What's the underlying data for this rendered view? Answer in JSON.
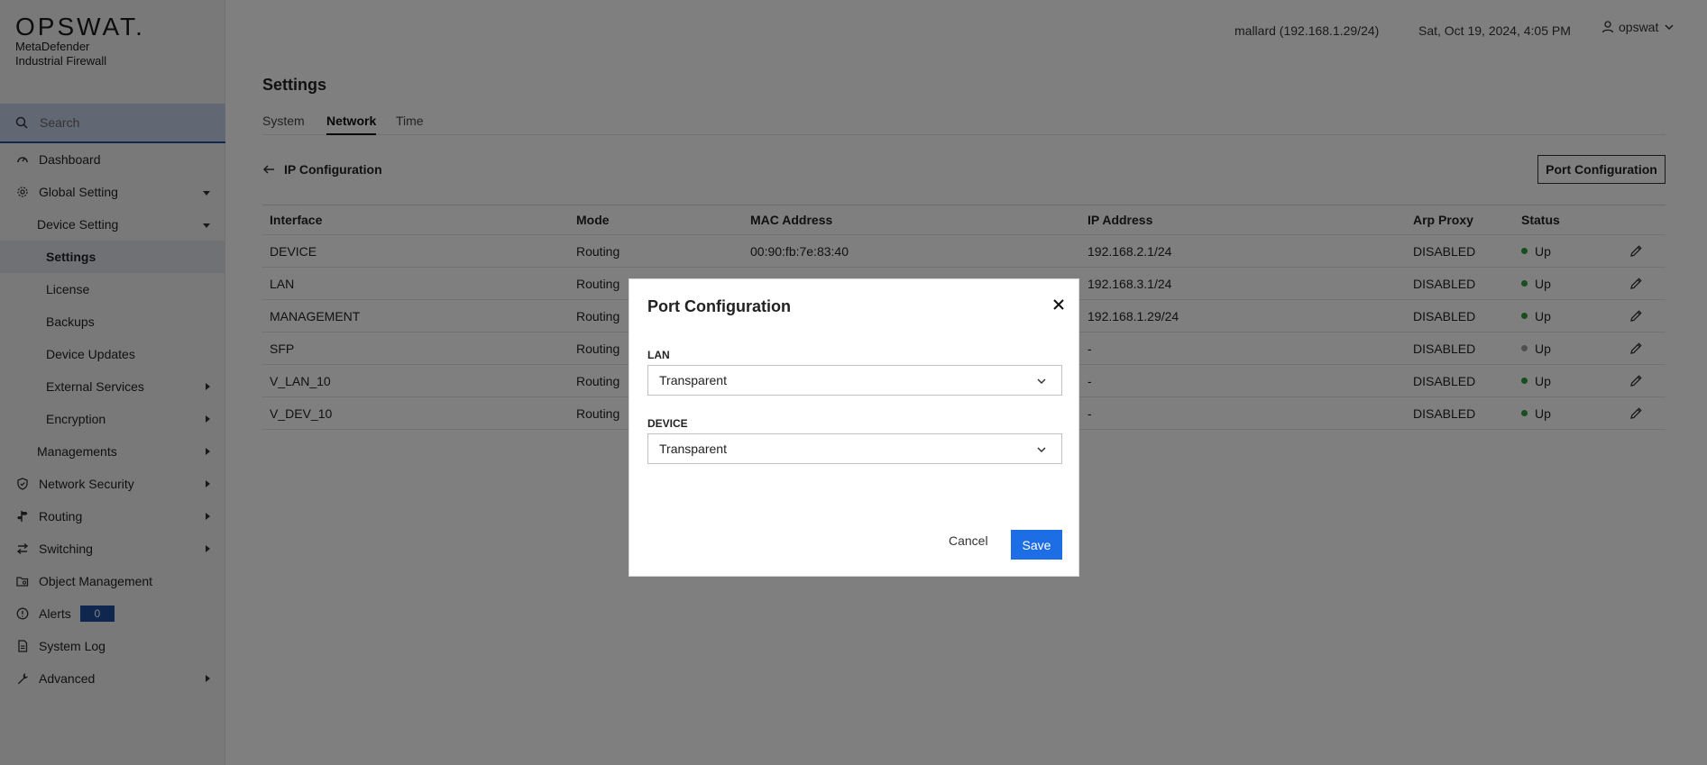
{
  "brand": {
    "logo": "OPSWAT.",
    "line1": "MetaDefender",
    "line2": "Industrial Firewall"
  },
  "search": {
    "placeholder": "Search"
  },
  "sidebar": {
    "items": [
      {
        "label": "Dashboard",
        "icon": "dashboard-icon"
      },
      {
        "label": "Global Setting",
        "icon": "gear-icon",
        "expanded": true
      },
      {
        "label": "Device Setting",
        "expanded": true
      },
      {
        "label": "Settings",
        "active": true
      },
      {
        "label": "License"
      },
      {
        "label": "Backups"
      },
      {
        "label": "Device Updates"
      },
      {
        "label": "External Services"
      },
      {
        "label": "Encryption"
      },
      {
        "label": "Managements"
      },
      {
        "label": "Network Security",
        "icon": "shield-icon"
      },
      {
        "label": "Routing",
        "icon": "signpost-icon"
      },
      {
        "label": "Switching",
        "icon": "swap-icon"
      },
      {
        "label": "Object Management",
        "icon": "folder-settings-icon"
      },
      {
        "label": "Alerts",
        "icon": "alert-circle-icon",
        "badge": "0"
      },
      {
        "label": "System Log",
        "icon": "log-file-icon"
      },
      {
        "label": "Advanced",
        "icon": "wrench-icon"
      }
    ]
  },
  "header": {
    "host": "mallard (192.168.1.29/24)",
    "datetime": "Sat, Oct 19, 2024, 4:05 PM",
    "user": "opswat"
  },
  "page": {
    "title": "Settings",
    "tabs": [
      "System",
      "Network",
      "Time"
    ],
    "active_tab": "Network",
    "section": "IP Configuration",
    "port_button": "Port Configuration"
  },
  "table": {
    "headers": [
      "Interface",
      "Mode",
      "MAC Address",
      "IP Address",
      "Arp Proxy",
      "Status"
    ],
    "rows": [
      {
        "interface": "DEVICE",
        "mode": "Routing",
        "mac": "00:90:fb:7e:83:40",
        "ip": "192.168.2.1/24",
        "arp": "DISABLED",
        "status": "Up",
        "status_color": "#2e9c3a"
      },
      {
        "interface": "LAN",
        "mode": "Routing",
        "mac": "",
        "ip": "192.168.3.1/24",
        "arp": "DISABLED",
        "status": "Up",
        "status_color": "#2e9c3a"
      },
      {
        "interface": "MANAGEMENT",
        "mode": "Routing",
        "mac": "",
        "ip": "192.168.1.29/24",
        "arp": "DISABLED",
        "status": "Up",
        "status_color": "#2e9c3a"
      },
      {
        "interface": "SFP",
        "mode": "Routing",
        "mac": "",
        "ip": "-",
        "arp": "DISABLED",
        "status": "Up",
        "status_color": "#9aa0a6"
      },
      {
        "interface": "V_LAN_10",
        "mode": "Routing",
        "mac": "",
        "ip": "-",
        "arp": "DISABLED",
        "status": "Up",
        "status_color": "#2e9c3a"
      },
      {
        "interface": "V_DEV_10",
        "mode": "Routing",
        "mac": "",
        "ip": "-",
        "arp": "DISABLED",
        "status": "Up",
        "status_color": "#2e9c3a"
      }
    ]
  },
  "modal": {
    "title": "Port Configuration",
    "fields": [
      {
        "label": "LAN",
        "value": "Transparent"
      },
      {
        "label": "DEVICE",
        "value": "Transparent"
      }
    ],
    "cancel_label": "Cancel",
    "save_label": "Save"
  },
  "colors": {
    "accent": "#1d6de5",
    "badge": "#1f4e9c",
    "status_up": "#2e9c3a"
  }
}
